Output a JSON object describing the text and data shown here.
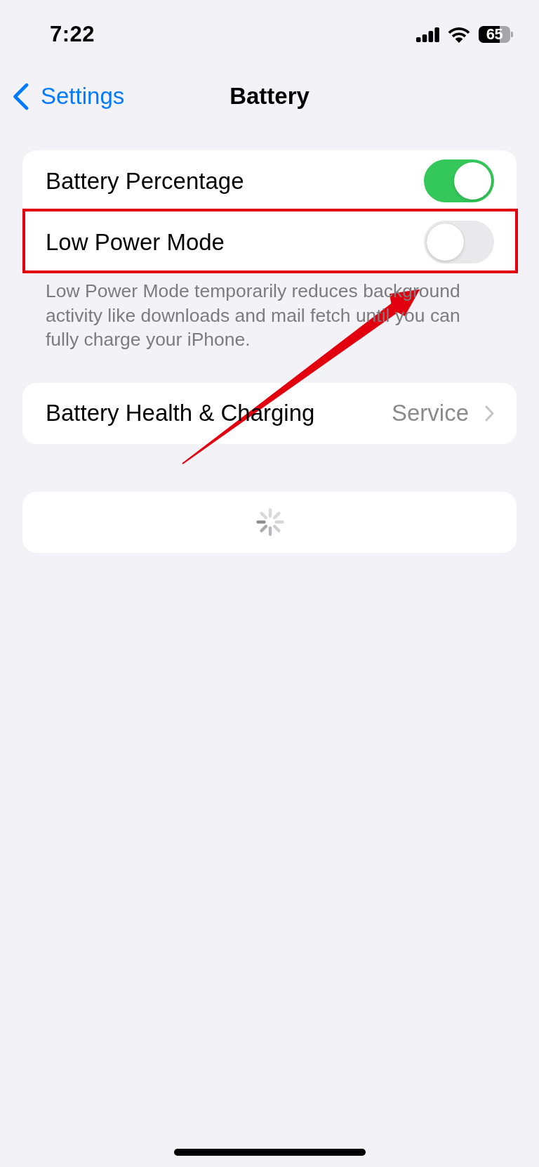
{
  "status_bar": {
    "time": "7:22",
    "battery": "65"
  },
  "nav_bar": {
    "back_label": "Settings",
    "title": "Battery"
  },
  "groups": [
    {
      "rows": [
        {
          "kind": "toggle",
          "label": "Battery Percentage",
          "on": true,
          "highlighted": false
        },
        {
          "kind": "toggle",
          "label": "Low Power Mode",
          "on": false,
          "highlighted": true
        }
      ],
      "footer": "Low Power Mode temporarily reduces background activity like downloads and mail fetch until you can fully charge your iPhone."
    },
    {
      "rows": [
        {
          "kind": "link",
          "label": "Battery Health & Charging",
          "value": "Service"
        }
      ]
    },
    {
      "rows": [
        {
          "kind": "loading"
        }
      ]
    }
  ]
}
